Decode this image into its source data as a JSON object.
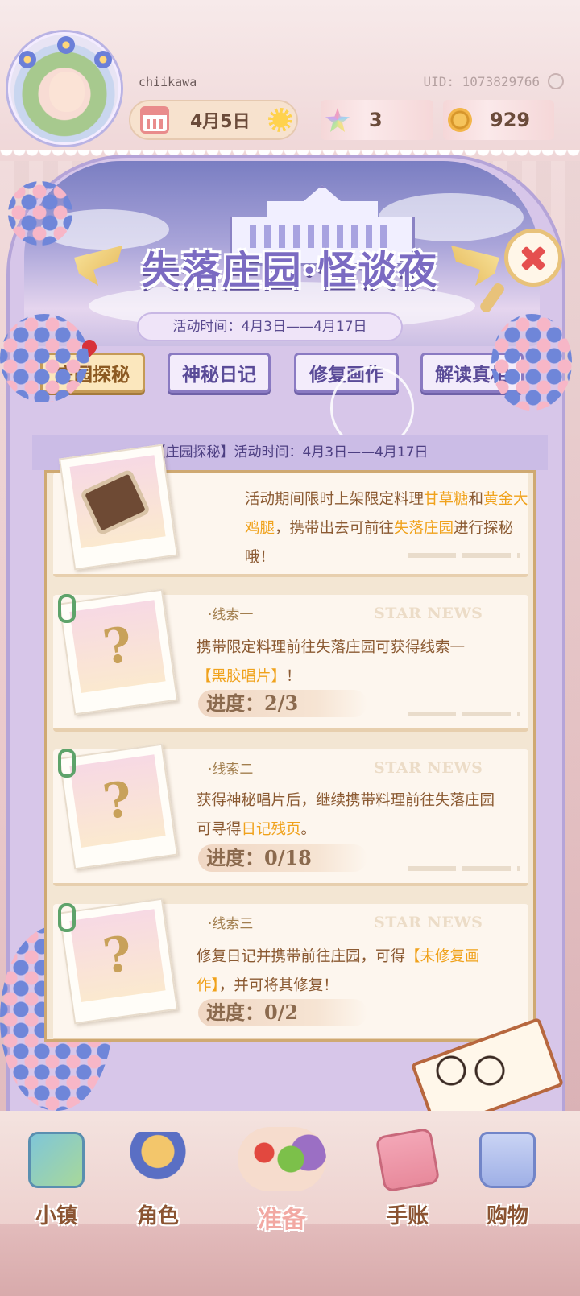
{
  "header": {
    "username": "chiikawa",
    "uid": "UID: 1073829766",
    "date": "4月5日",
    "weather_icon": "sun-icon",
    "gems": "3",
    "coins": "929"
  },
  "banner": {
    "title": "失落庄园·怪谈夜",
    "period": "活动时间：4月3日——4月17日"
  },
  "tabs": [
    {
      "label": "庄园探秘",
      "active": true
    },
    {
      "label": "神秘日记",
      "active": false
    },
    {
      "label": "修复画作",
      "active": false
    },
    {
      "label": "解读真相",
      "active": false
    }
  ],
  "section": {
    "header": "【庄园探秘】活动时间：4月3日——4月17日"
  },
  "cards": {
    "intro": {
      "text_a": "活动期间限时上架限定料理",
      "hl_a": "甘草糖",
      "text_b": "和",
      "hl_b": "黄金大鸡腿",
      "text_c": "，携带出去可前往",
      "hl_c": "失落庄园",
      "text_d": "进行探秘哦！"
    },
    "clue1": {
      "label": "·线索一",
      "badge": "STAR NEWS",
      "text_a": "携带限定料理前往失落庄园可获得线索一",
      "hl_a": "【黑胶唱片】",
      "text_b": "！",
      "progress": "进度：2/3"
    },
    "clue2": {
      "label": "·线索二",
      "badge": "STAR NEWS",
      "text_a": "获得神秘唱片后，继续携带料理前往失落庄园可寻得",
      "hl_a": "日记残页",
      "text_b": "。",
      "progress": "进度：0/18"
    },
    "clue3": {
      "label": "·线索三",
      "badge": "STAR NEWS",
      "text_a": "修复日记并携带前往庄园，可得",
      "hl_a": "【未修复画作】",
      "text_b": "，并可将其修复！",
      "progress": "进度：0/2"
    },
    "question_mark": "?"
  },
  "nav": [
    {
      "label": "小镇",
      "icon": "map-icon"
    },
    {
      "label": "角色",
      "icon": "character-icon"
    },
    {
      "label": "准备",
      "icon": "food-icon"
    },
    {
      "label": "手账",
      "icon": "journal-icon"
    },
    {
      "label": "购物",
      "icon": "shopping-bag-icon"
    }
  ],
  "colors": {
    "highlight": "#f0a21c",
    "body_text": "#8b5a32",
    "tab_active": "#fbe7bd",
    "tab": "#f3ecfb"
  }
}
